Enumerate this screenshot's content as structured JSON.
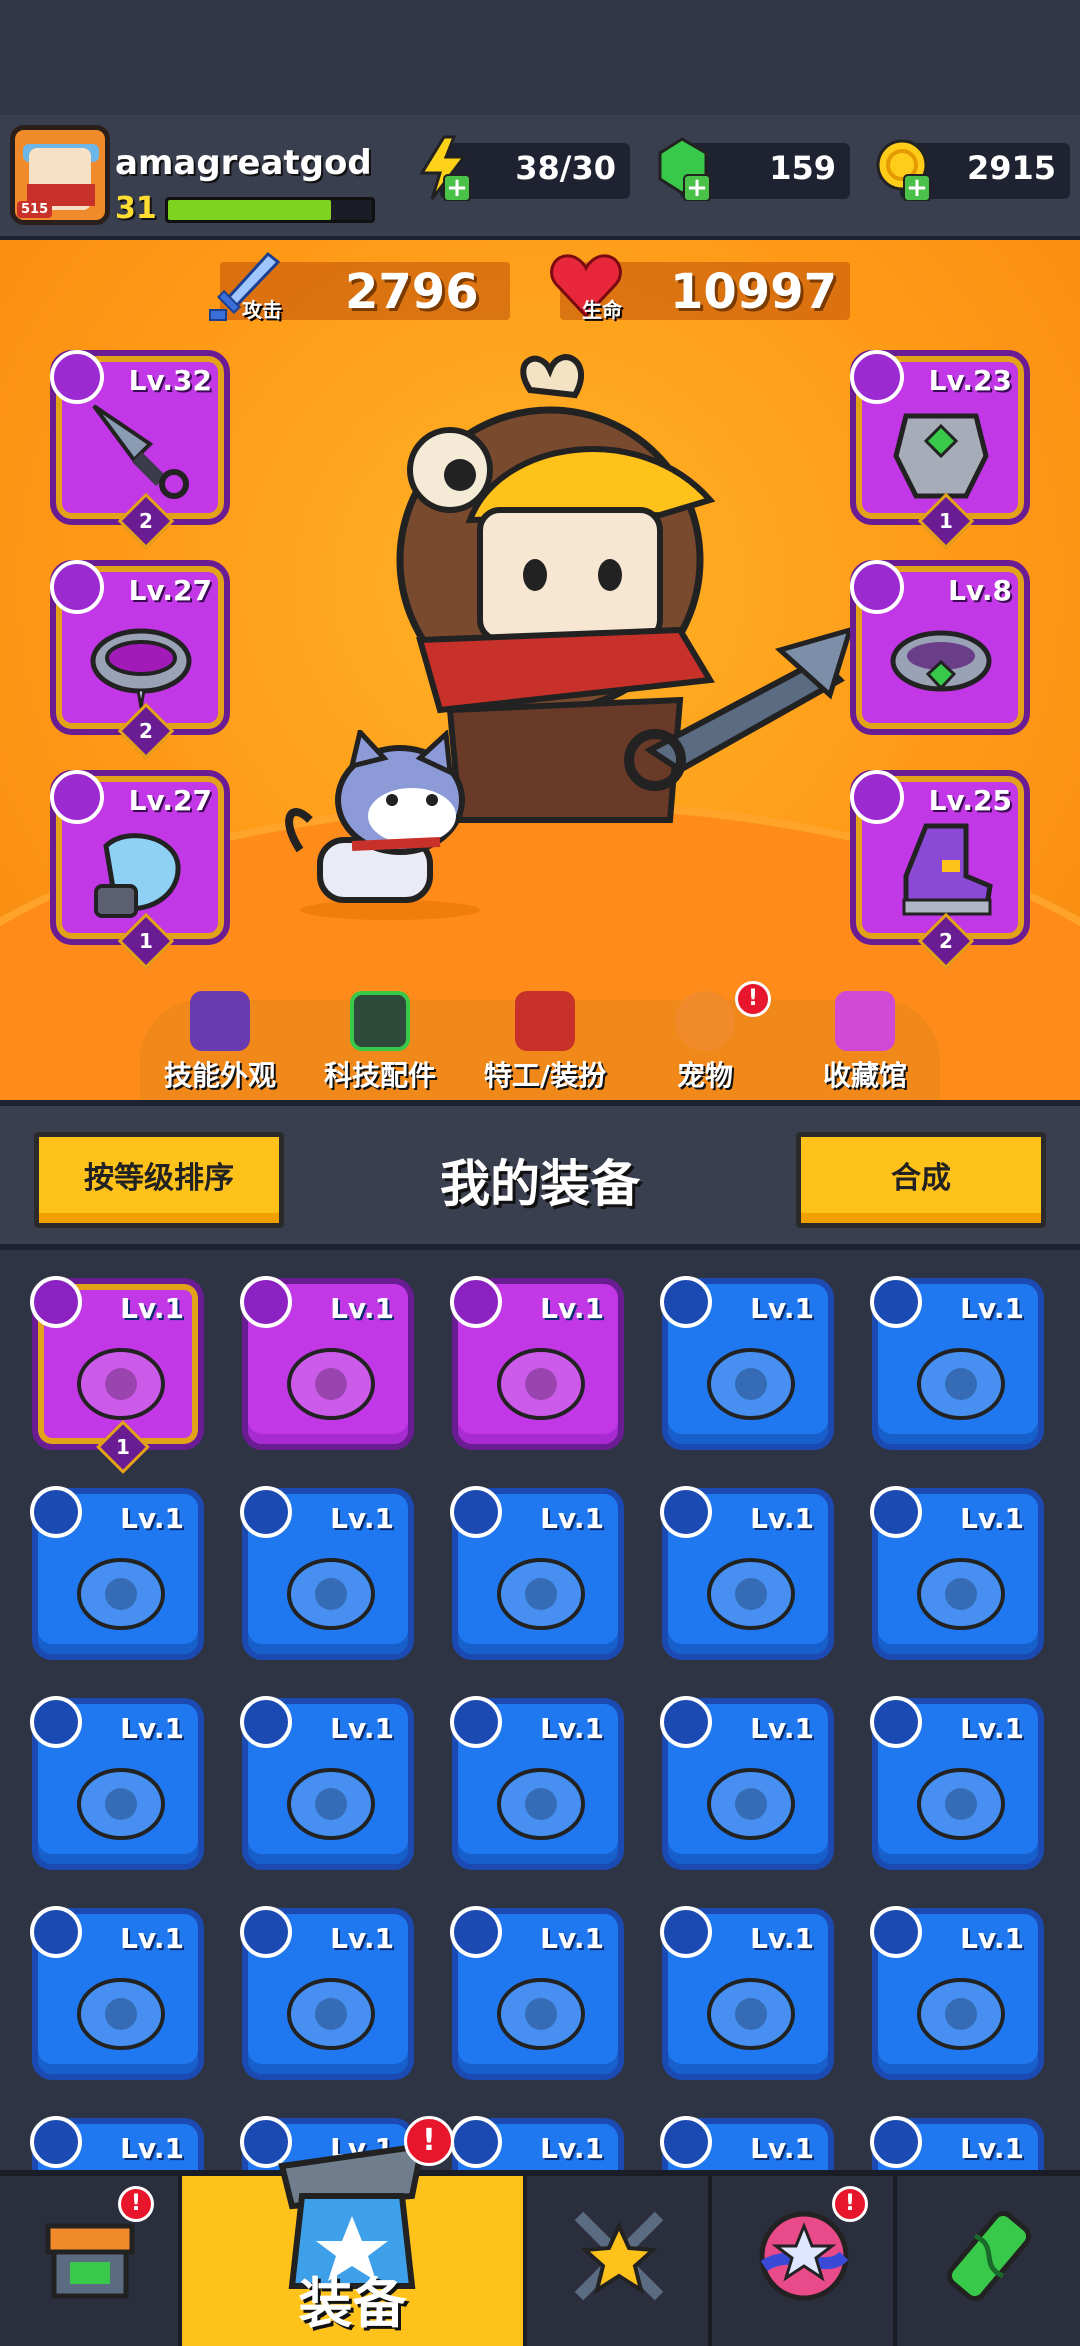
{
  "player": {
    "name": "amagreatgod",
    "level": "31",
    "avatar_badge": "515",
    "xp_fraction": 0.8
  },
  "resources": {
    "energy": "38/30",
    "gems": "159",
    "coins": "2915"
  },
  "stats": {
    "attack_value": "2796",
    "attack_label": "攻击",
    "hp_value": "10997",
    "hp_label": "生命"
  },
  "equipped_left": [
    {
      "level": "Lv.32",
      "stars": "2",
      "item": "kunai"
    },
    {
      "level": "Lv.27",
      "stars": "2",
      "item": "spiked-collar"
    },
    {
      "level": "Lv.27",
      "stars": "1",
      "item": "claw-glove"
    }
  ],
  "equipped_right": [
    {
      "level": "Lv.23",
      "stars": "1",
      "item": "armor"
    },
    {
      "level": "Lv.8",
      "stars": "",
      "item": "gem-belt"
    },
    {
      "level": "Lv.25",
      "stars": "2",
      "item": "boots"
    }
  ],
  "hero_nav": [
    {
      "label": "技能外观",
      "icon": "skill-skin-icon"
    },
    {
      "label": "科技配件",
      "icon": "tech-part-icon"
    },
    {
      "label": "特工/装扮",
      "icon": "agent-icon"
    },
    {
      "label": "宠物",
      "icon": "pet-icon",
      "badge": "!"
    },
    {
      "label": "收藏馆",
      "icon": "collection-icon"
    }
  ],
  "equipment": {
    "sort_label": "按等级排序",
    "title": "我的装备",
    "merge_label": "合成"
  },
  "grid_items": [
    {
      "level": "Lv.1",
      "rarity": "purple",
      "stars": "1",
      "item": "shotgun"
    },
    {
      "level": "Lv.1",
      "rarity": "purple",
      "item": "leaf-armor"
    },
    {
      "level": "Lv.1",
      "rarity": "purple",
      "item": "spiked-collar"
    },
    {
      "level": "Lv.1",
      "rarity": "blue",
      "item": "machete"
    },
    {
      "level": "Lv.1",
      "rarity": "blue",
      "item": "bat"
    },
    {
      "level": "Lv.1",
      "rarity": "blue",
      "item": "bat"
    },
    {
      "level": "Lv.1",
      "rarity": "blue",
      "item": "red-vest"
    },
    {
      "level": "Lv.1",
      "rarity": "blue",
      "item": "steel-vest"
    },
    {
      "level": "Lv.1",
      "rarity": "blue",
      "item": "camo-shirt"
    },
    {
      "level": "Lv.1",
      "rarity": "blue",
      "item": "bone-necklace"
    },
    {
      "level": "Lv.1",
      "rarity": "blue",
      "item": "bone-necklace"
    },
    {
      "level": "Lv.1",
      "rarity": "blue",
      "item": "emerald-necklace"
    },
    {
      "level": "Lv.1",
      "rarity": "blue",
      "item": "blue-collar"
    },
    {
      "level": "Lv.1",
      "rarity": "blue",
      "item": "tag-collar"
    },
    {
      "level": "Lv.1",
      "rarity": "blue",
      "item": "bandage-belt"
    },
    {
      "level": "Lv.1",
      "rarity": "blue",
      "item": "green-belt"
    },
    {
      "level": "Lv.1",
      "rarity": "blue",
      "item": "gold-belt"
    },
    {
      "level": "Lv.1",
      "rarity": "blue",
      "item": "buckle-belt"
    },
    {
      "level": "Lv.1",
      "rarity": "blue",
      "item": "bandage-glove"
    },
    {
      "level": "Lv.1",
      "rarity": "blue",
      "item": "leather-glove"
    },
    {
      "level": "Lv.1",
      "rarity": "blue",
      "item": "glove"
    },
    {
      "level": "Lv.1",
      "rarity": "blue",
      "item": "glove"
    },
    {
      "level": "Lv.1",
      "rarity": "blue",
      "item": "boots"
    },
    {
      "level": "Lv.1",
      "rarity": "blue",
      "item": "boots"
    },
    {
      "level": "Lv.1",
      "rarity": "blue",
      "item": "boots"
    }
  ],
  "tabs": [
    {
      "name": "shop",
      "badge": "!"
    },
    {
      "name": "equipment",
      "label": "装备",
      "badge": "!"
    },
    {
      "name": "battle"
    },
    {
      "name": "events",
      "badge": "!"
    },
    {
      "name": "lab"
    }
  ],
  "colors": {
    "accent": "#ffc21a",
    "purple": "#c238e6",
    "blue": "#1f78f0",
    "orange": "#ff9a17"
  }
}
